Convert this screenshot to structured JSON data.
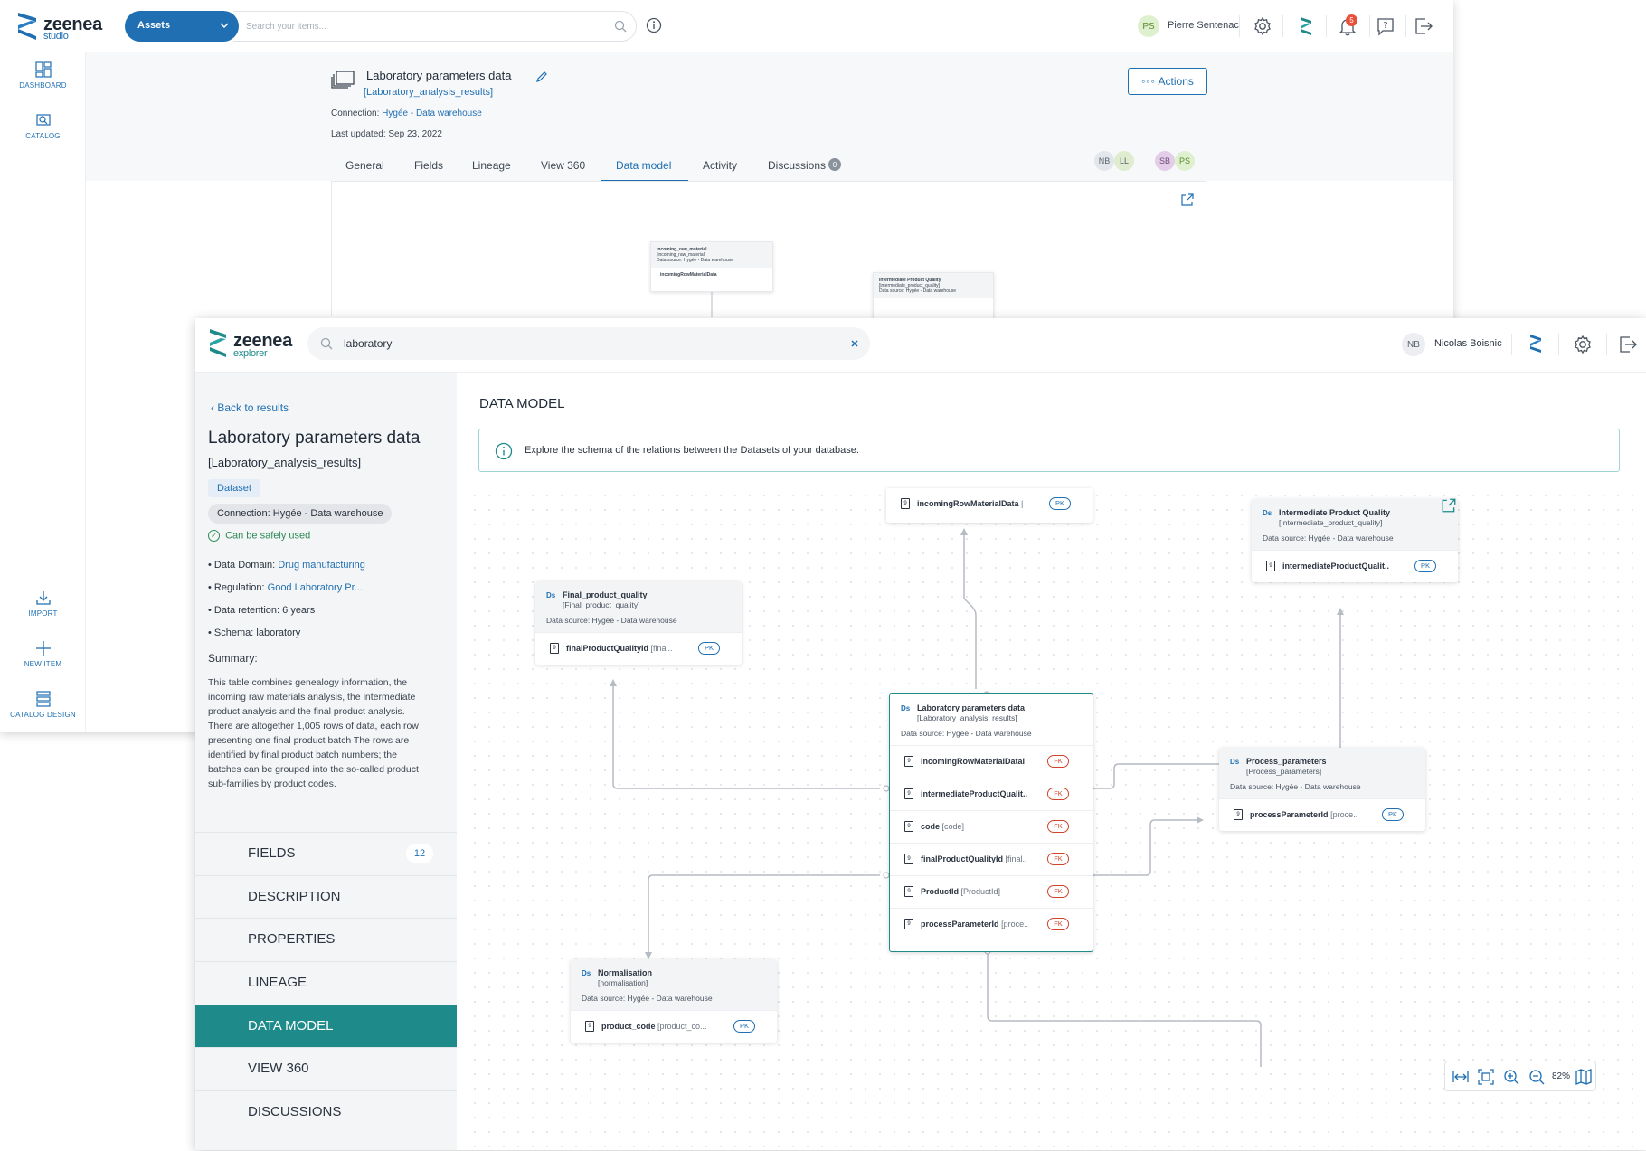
{
  "studio": {
    "brand": "zeenea",
    "brand_sub": "studio",
    "assets_label": "Assets",
    "search_placeholder": "Search your items...",
    "user_initials": "PS",
    "user_name": "Pierre Sentenac",
    "notification_count": "5",
    "sidebar": [
      {
        "label": "DASHBOARD",
        "icon": "dashboard-icon"
      },
      {
        "label": "CATALOG",
        "icon": "catalog-icon"
      },
      {
        "label": "IMPORT",
        "icon": "import-icon"
      },
      {
        "label": "NEW ITEM",
        "icon": "plus-icon"
      },
      {
        "label": "CATALOG DESIGN",
        "icon": "catalog-design-icon"
      }
    ],
    "item": {
      "title": "Laboratory parameters data",
      "physical_name": "[Laboratory_analysis_results]",
      "connection_label": "Connection:",
      "connection_value": "Hygée - Data warehouse",
      "last_updated": "Last updated: Sep 23, 2022",
      "actions_label": "Actions"
    },
    "tabs": [
      "General",
      "Fields",
      "Lineage",
      "View 360",
      "Data model",
      "Activity",
      "Discussions"
    ],
    "active_tab": "Data model",
    "discussions_count": "0",
    "contributors": [
      "NB",
      "LL",
      "SB",
      "PS"
    ],
    "mini_cards": [
      {
        "title": "Incoming_raw_material",
        "phys": "[incoming_raw_material]",
        "src": "Data source: Hygée - Data warehouse",
        "field": "incomingRowMaterialData"
      },
      {
        "title": "Intermediate Product Quality",
        "phys": "[intermediate_product_quality]",
        "src": "Data source: Hygée - Data warehouse",
        "field": "intermediateProductQualit"
      }
    ]
  },
  "explorer": {
    "brand": "zeenea",
    "brand_sub": "explorer",
    "search_value": "laboratory",
    "user_initials": "NB",
    "user_name": "Nicolas Boisnic",
    "back_label": "Back to results",
    "title": "Laboratory parameters data",
    "physical_name": "[Laboratory_analysis_results]",
    "type_badge": "Dataset",
    "connection": "Connection:  Hygée - Data warehouse",
    "safe_label": "Can be safely used",
    "properties": [
      {
        "key": "Data Domain: ",
        "value": "Drug manufacturing"
      },
      {
        "key": "Regulation: ",
        "value": "Good Laboratory Pr..."
      },
      {
        "key": "Data retention:  ",
        "value": "6 years"
      },
      {
        "key": "Schema:  ",
        "value": "laboratory"
      }
    ],
    "summary_label": "Summary:",
    "summary_lines": [
      "This table combines genealogy information, the",
      "incoming raw materials analysis, the intermediate",
      "product analysis and the final product analysis.",
      "There are altogether 1,005 rows of data, each row",
      "presenting one final product batch The rows are",
      "identified by final product batch numbers; the",
      "batches can be grouped into the so-called product",
      "sub-families by product codes."
    ],
    "menu": [
      "FIELDS",
      "DESCRIPTION",
      "PROPERTIES",
      "LINEAGE",
      "DATA MODEL",
      "VIEW 360",
      "DISCUSSIONS"
    ],
    "fields_count": "12",
    "active_menu": "DATA MODEL",
    "section_title": "DATA MODEL",
    "info_text": "Explore the schema of the relations between the Datasets of your database.",
    "zoom_level": "82%",
    "cards": {
      "incoming": {
        "fields": [
          {
            "name": "incomingRowMaterialData",
            "phys": "|",
            "key": "PK"
          }
        ]
      },
      "intermediate": {
        "title": "Intermediate Product Quality",
        "phys": "[Intermediate_product_quality]",
        "src": "Data source: Hygée - Data warehouse",
        "fields": [
          {
            "name": "intermediateProductQualit..",
            "phys": "",
            "key": "PK"
          }
        ]
      },
      "final": {
        "title": "Final_product_quality",
        "phys": "[Final_product_quality]",
        "src": "Data source: Hygée - Data warehouse",
        "fields": [
          {
            "name": "finalProductQualityId",
            "phys": "[final..",
            "key": "PK"
          }
        ]
      },
      "main": {
        "title": "Laboratory parameters data",
        "phys": "[Laboratory_analysis_results]",
        "src": "Data source: Hygée - Data warehouse",
        "fields": [
          {
            "name": "incomingRowMaterialDatal",
            "phys": "",
            "key": "FK"
          },
          {
            "name": "intermediateProductQualit..",
            "phys": "",
            "key": "FK"
          },
          {
            "name": "code",
            "phys": "[code]",
            "key": "FK"
          },
          {
            "name": "finalProductQualityId",
            "phys": "[final..",
            "key": "FK"
          },
          {
            "name": "ProductId",
            "phys": "[ProductId]",
            "key": "FK"
          },
          {
            "name": "processParameterId",
            "phys": "[proce..",
            "key": "FK"
          }
        ]
      },
      "process": {
        "title": "Process_parameters",
        "phys": "[Process_parameters]",
        "src": "Data source: Hygée - Data warehouse",
        "fields": [
          {
            "name": "processParameterId",
            "phys": "[proce..",
            "key": "PK"
          }
        ]
      },
      "normalisation": {
        "title": "Normalisation",
        "phys": "[normalisation]",
        "src": "Data source: Hygée - Data warehouse",
        "fields": [
          {
            "name": "product_code",
            "phys": "[product_co...",
            "key": "PK"
          }
        ]
      }
    }
  },
  "colors": {
    "brand_blue": "#1f6fb2",
    "teal": "#1e8a8a",
    "fk_red": "#d0442b",
    "notification": "#e8503a"
  }
}
